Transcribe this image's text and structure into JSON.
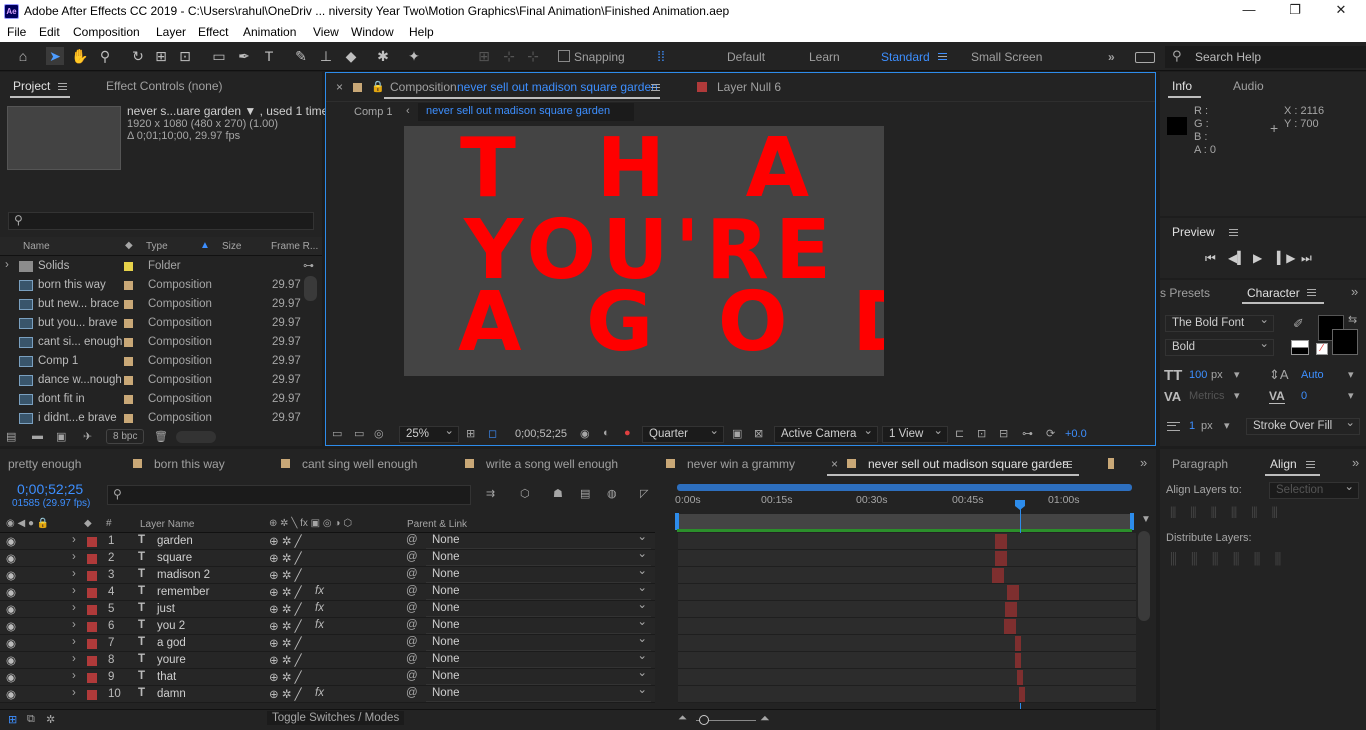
{
  "window": {
    "title": "Adobe After Effects CC 2019 - C:\\Users\\rahul\\OneDriv ... niversity Year Two\\Motion Graphics\\Final Animation\\Finished Animation.aep",
    "logo": "Ae",
    "min": "—",
    "max": "❐",
    "close": "✕"
  },
  "menu": [
    "File",
    "Edit",
    "Composition",
    "Layer",
    "Effect",
    "Animation",
    "View",
    "Window",
    "Help"
  ],
  "toolbar": {
    "snapping": "Snapping",
    "workspaces": [
      "Default",
      "Learn",
      "Standard",
      "Small Screen"
    ],
    "active_workspace": "Standard",
    "search_placeholder": "Search Help"
  },
  "project": {
    "tab": "Project",
    "effect_tab": "Effect Controls (none)",
    "comp_name": "never s...uare garden ▼ , used 1 time",
    "dims": "1920 x 1080  (480 x 270) (1.00)",
    "duration": "Δ 0;01;10;00, 29.97 fps",
    "search_placeholder": "",
    "columns": [
      "Name",
      "Type",
      "Size",
      "Frame R..."
    ],
    "items": [
      {
        "name": "Solids",
        "type": "Folder",
        "fps": "",
        "color": "#e6d24a"
      },
      {
        "name": "born this way",
        "type": "Composition",
        "fps": "29.97",
        "color": "#c9a877"
      },
      {
        "name": "but new... brace",
        "type": "Composition",
        "fps": "29.97",
        "color": "#c9a877"
      },
      {
        "name": "but you... brave",
        "type": "Composition",
        "fps": "29.97",
        "color": "#c9a877"
      },
      {
        "name": "cant si... enough",
        "type": "Composition",
        "fps": "29.97",
        "color": "#c9a877"
      },
      {
        "name": "Comp 1",
        "type": "Composition",
        "fps": "29.97",
        "color": "#c9a877"
      },
      {
        "name": "dance w...nough",
        "type": "Composition",
        "fps": "29.97",
        "color": "#c9a877"
      },
      {
        "name": "dont fit in",
        "type": "Composition",
        "fps": "29.97",
        "color": "#c9a877"
      },
      {
        "name": "i didnt...e brave",
        "type": "Composition",
        "fps": "29.97",
        "color": "#c9a877"
      }
    ],
    "bpc": "8 bpc"
  },
  "viewer": {
    "tab_prefix": "Composition",
    "tab_comp": "never sell out madison square garden",
    "layer_tab": "Layer  Null 6",
    "crumb_parent": "Comp 1",
    "crumb_current": "never sell out madison square garden",
    "lines": [
      "T H A T",
      "YOU'RE",
      "A G O D"
    ],
    "zoom": "25%",
    "timecode": "0;00;52;25",
    "resolution": "Quarter",
    "camera": "Active Camera",
    "views": "1 View",
    "exposure": "+0.0"
  },
  "info": {
    "tab": "Info",
    "audio_tab": "Audio",
    "r": "R :",
    "g": "G :",
    "b": "B :",
    "a": "A :  0",
    "x": "X : 2116",
    "y": "Y :  700"
  },
  "preview": {
    "tab": "Preview"
  },
  "character": {
    "presets_tab": "s Presets",
    "tab": "Character",
    "font": "The Bold Font",
    "style": "Bold",
    "size": "100",
    "size_unit": "px",
    "leading": "Auto",
    "kerning": "Metrics",
    "tracking": "0",
    "stroke": "1",
    "stroke_unit": "px",
    "stroke_mode": "Stroke Over Fill"
  },
  "paragraph": {
    "tab": "Paragraph",
    "align_tab": "Align",
    "align_to_label": "Align Layers to:",
    "align_to_value": "Selection",
    "distribute_label": "Distribute Layers:"
  },
  "timeline": {
    "tabs": [
      {
        "label": "pretty enough",
        "color": ""
      },
      {
        "label": "born this way",
        "color": "#c9a877"
      },
      {
        "label": "cant sing well enough",
        "color": "#c9a877"
      },
      {
        "label": "write a song well enough",
        "color": "#c9a877"
      },
      {
        "label": "never win a grammy",
        "color": "#c9a877"
      },
      {
        "label": "never sell out madison square garden",
        "color": "#c9a877"
      }
    ],
    "timecode": "0;00;52;25",
    "frame_info": "01585 (29.97 fps)",
    "col_layer": "Layer Name",
    "col_parent": "Parent & Link",
    "ruler": [
      "0:00s",
      "00:15s",
      "00:30s",
      "00:45s",
      "01:00s"
    ],
    "layers": [
      {
        "num": "1",
        "name": "garden",
        "fx": "",
        "parent": "None"
      },
      {
        "num": "2",
        "name": "square",
        "fx": "",
        "parent": "None"
      },
      {
        "num": "3",
        "name": "madison 2",
        "fx": "",
        "parent": "None"
      },
      {
        "num": "4",
        "name": "remember",
        "fx": "fx",
        "parent": "None"
      },
      {
        "num": "5",
        "name": "just",
        "fx": "fx",
        "parent": "None"
      },
      {
        "num": "6",
        "name": "you 2",
        "fx": "fx",
        "parent": "None"
      },
      {
        "num": "7",
        "name": "a god",
        "fx": "",
        "parent": "None"
      },
      {
        "num": "8",
        "name": "youre",
        "fx": "",
        "parent": "None"
      },
      {
        "num": "9",
        "name": "that",
        "fx": "",
        "parent": "None"
      },
      {
        "num": "10",
        "name": "damn",
        "fx": "fx",
        "parent": "None"
      }
    ],
    "toggle_label": "Toggle Switches / Modes"
  },
  "colors": {
    "accent": "#2d8ceb",
    "label_red": "#b03a3a",
    "text_red": "#ff0000",
    "bar_red": "#7e2f2f"
  }
}
